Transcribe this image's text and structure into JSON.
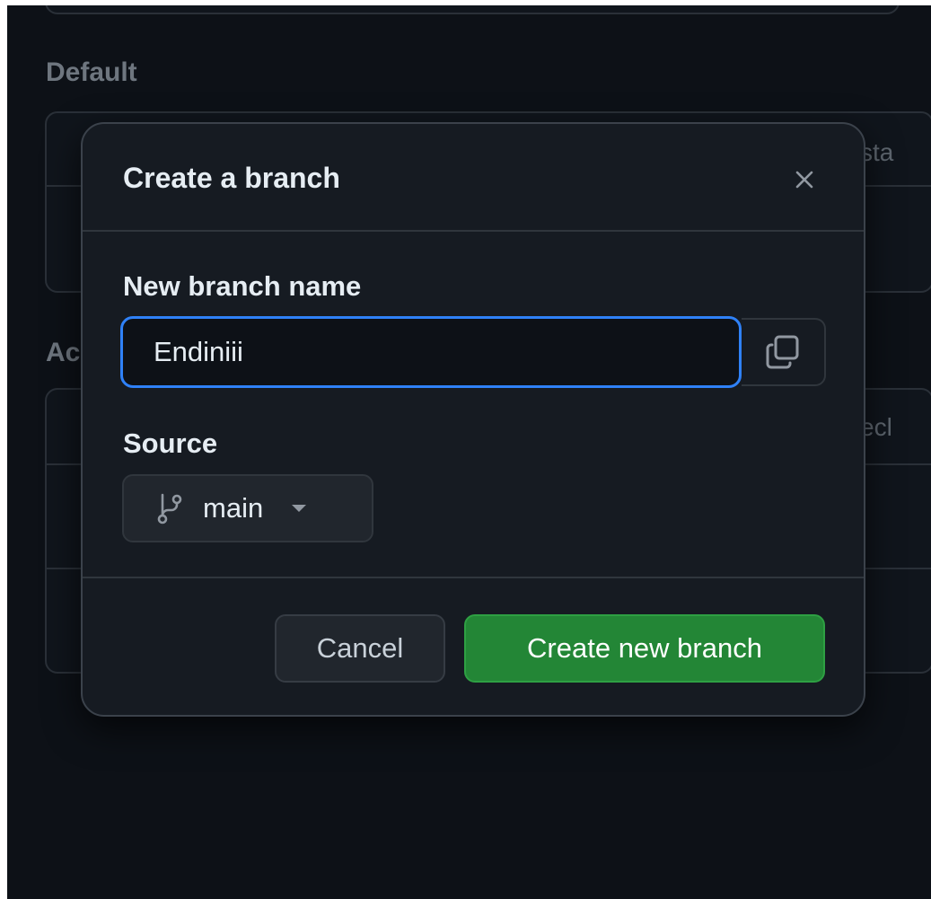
{
  "background": {
    "section_default": "Default",
    "section_active_partial": "Ac",
    "col_partial_status": "sta",
    "col_partial_check": "ecl"
  },
  "dialog": {
    "title": "Create a branch",
    "close_icon": "close-icon",
    "name_label": "New branch name",
    "name_value": "Endiniii",
    "copy_icon": "copy-icon",
    "source_label": "Source",
    "source_branch": "main",
    "branch_icon": "git-branch-icon",
    "caret_icon": "caret-down-icon",
    "cancel_label": "Cancel",
    "create_label": "Create new branch"
  },
  "colors": {
    "accent_focus": "#2f81f7",
    "primary_button": "#238636",
    "dialog_bg": "#161b22",
    "page_bg": "#0d1117"
  }
}
